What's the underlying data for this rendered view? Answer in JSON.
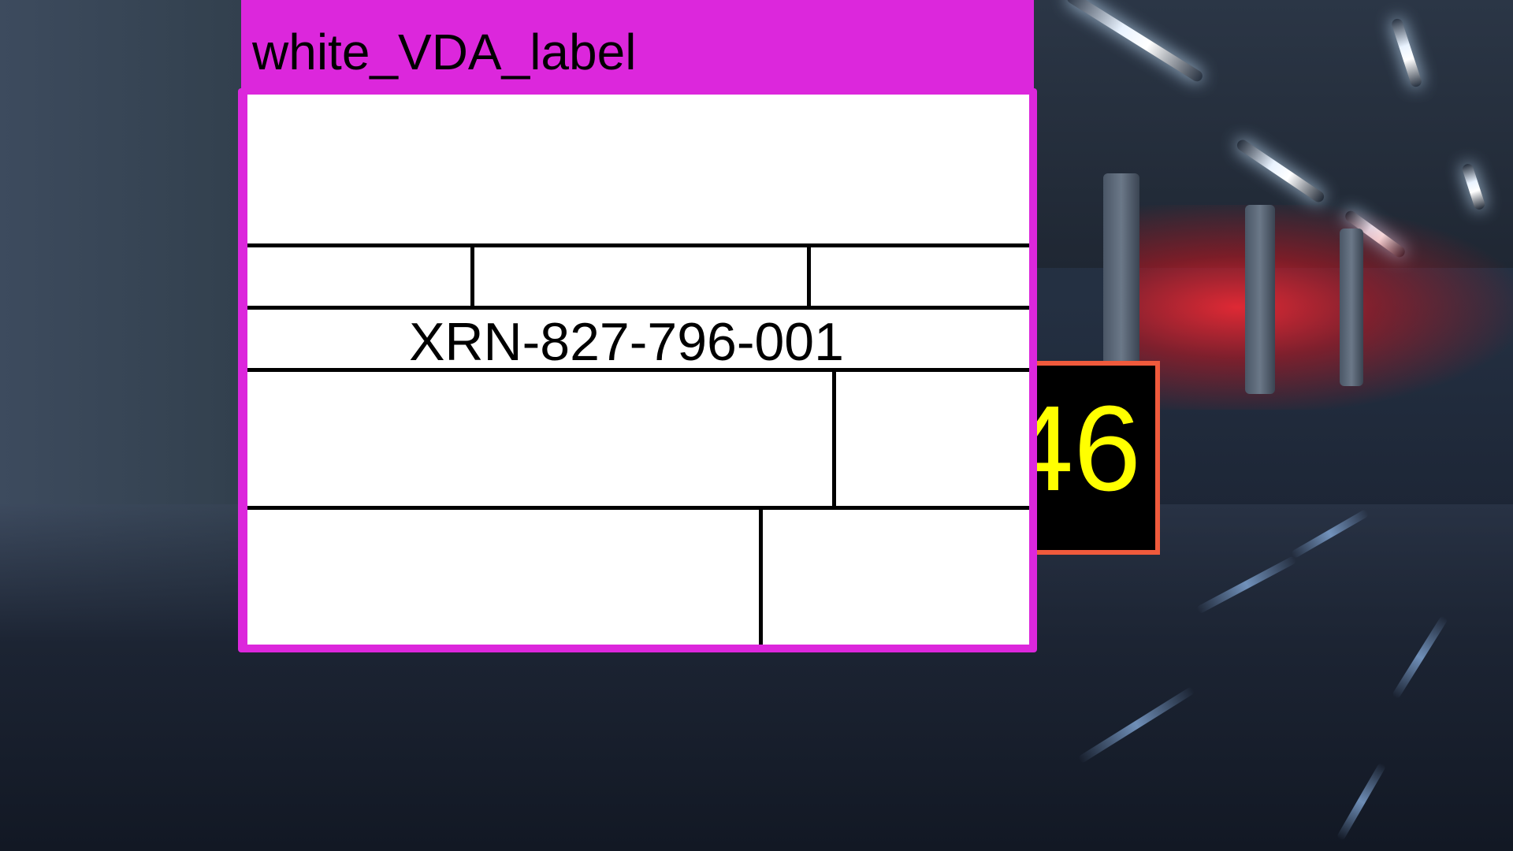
{
  "panel": {
    "title": "white_VDA_label",
    "accent_color": "#dc27dc"
  },
  "label": {
    "part_number": "XRN-827-796-001",
    "background_color": "#ffffff"
  },
  "badge": {
    "text": "46",
    "text_color": "#ffff00",
    "border_color": "#f05a3c"
  }
}
